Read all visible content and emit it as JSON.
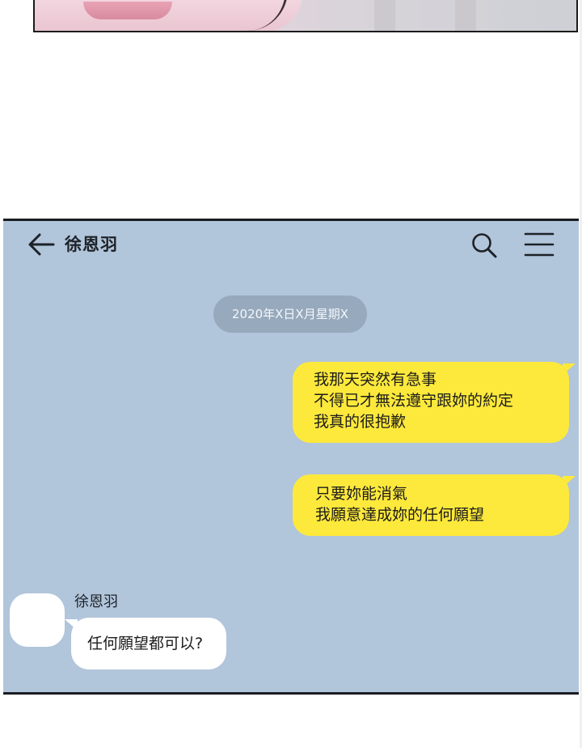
{
  "chat": {
    "header": {
      "contact_name": "徐恩羽",
      "back_icon": "arrow-left-icon",
      "search_icon": "search-icon",
      "menu_icon": "hamburger-menu-icon"
    },
    "date_label": "2020年X日X月星期X",
    "outgoing_messages": [
      {
        "lines": [
          "我那天突然有急事",
          "不得已才無法遵守跟妳的約定",
          "我真的很抱歉"
        ]
      },
      {
        "lines": [
          "只要妳能消氣",
          "我願意達成妳的任何願望"
        ]
      }
    ],
    "incoming_messages": [
      {
        "sender": "徐恩羽",
        "text": "任何願望都可以?"
      }
    ],
    "colors": {
      "background": "#b1c5db",
      "outgoing_bubble": "#fde93b",
      "incoming_bubble": "#ffffff",
      "date_pill": "#97a9bc"
    }
  }
}
